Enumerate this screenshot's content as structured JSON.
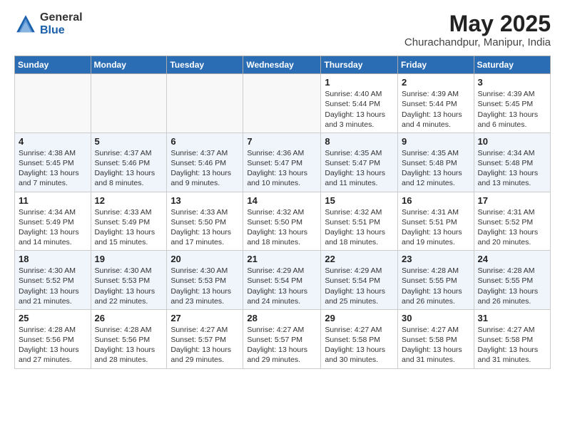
{
  "logo": {
    "general": "General",
    "blue": "Blue"
  },
  "title": "May 2025",
  "subtitle": "Churachandpur, Manipur, India",
  "headers": [
    "Sunday",
    "Monday",
    "Tuesday",
    "Wednesday",
    "Thursday",
    "Friday",
    "Saturday"
  ],
  "rows": [
    [
      {
        "day": "",
        "info": ""
      },
      {
        "day": "",
        "info": ""
      },
      {
        "day": "",
        "info": ""
      },
      {
        "day": "",
        "info": ""
      },
      {
        "day": "1",
        "info": "Sunrise: 4:40 AM\nSunset: 5:44 PM\nDaylight: 13 hours and 3 minutes."
      },
      {
        "day": "2",
        "info": "Sunrise: 4:39 AM\nSunset: 5:44 PM\nDaylight: 13 hours and 4 minutes."
      },
      {
        "day": "3",
        "info": "Sunrise: 4:39 AM\nSunset: 5:45 PM\nDaylight: 13 hours and 6 minutes."
      }
    ],
    [
      {
        "day": "4",
        "info": "Sunrise: 4:38 AM\nSunset: 5:45 PM\nDaylight: 13 hours and 7 minutes."
      },
      {
        "day": "5",
        "info": "Sunrise: 4:37 AM\nSunset: 5:46 PM\nDaylight: 13 hours and 8 minutes."
      },
      {
        "day": "6",
        "info": "Sunrise: 4:37 AM\nSunset: 5:46 PM\nDaylight: 13 hours and 9 minutes."
      },
      {
        "day": "7",
        "info": "Sunrise: 4:36 AM\nSunset: 5:47 PM\nDaylight: 13 hours and 10 minutes."
      },
      {
        "day": "8",
        "info": "Sunrise: 4:35 AM\nSunset: 5:47 PM\nDaylight: 13 hours and 11 minutes."
      },
      {
        "day": "9",
        "info": "Sunrise: 4:35 AM\nSunset: 5:48 PM\nDaylight: 13 hours and 12 minutes."
      },
      {
        "day": "10",
        "info": "Sunrise: 4:34 AM\nSunset: 5:48 PM\nDaylight: 13 hours and 13 minutes."
      }
    ],
    [
      {
        "day": "11",
        "info": "Sunrise: 4:34 AM\nSunset: 5:49 PM\nDaylight: 13 hours and 14 minutes."
      },
      {
        "day": "12",
        "info": "Sunrise: 4:33 AM\nSunset: 5:49 PM\nDaylight: 13 hours and 15 minutes."
      },
      {
        "day": "13",
        "info": "Sunrise: 4:33 AM\nSunset: 5:50 PM\nDaylight: 13 hours and 17 minutes."
      },
      {
        "day": "14",
        "info": "Sunrise: 4:32 AM\nSunset: 5:50 PM\nDaylight: 13 hours and 18 minutes."
      },
      {
        "day": "15",
        "info": "Sunrise: 4:32 AM\nSunset: 5:51 PM\nDaylight: 13 hours and 18 minutes."
      },
      {
        "day": "16",
        "info": "Sunrise: 4:31 AM\nSunset: 5:51 PM\nDaylight: 13 hours and 19 minutes."
      },
      {
        "day": "17",
        "info": "Sunrise: 4:31 AM\nSunset: 5:52 PM\nDaylight: 13 hours and 20 minutes."
      }
    ],
    [
      {
        "day": "18",
        "info": "Sunrise: 4:30 AM\nSunset: 5:52 PM\nDaylight: 13 hours and 21 minutes."
      },
      {
        "day": "19",
        "info": "Sunrise: 4:30 AM\nSunset: 5:53 PM\nDaylight: 13 hours and 22 minutes."
      },
      {
        "day": "20",
        "info": "Sunrise: 4:30 AM\nSunset: 5:53 PM\nDaylight: 13 hours and 23 minutes."
      },
      {
        "day": "21",
        "info": "Sunrise: 4:29 AM\nSunset: 5:54 PM\nDaylight: 13 hours and 24 minutes."
      },
      {
        "day": "22",
        "info": "Sunrise: 4:29 AM\nSunset: 5:54 PM\nDaylight: 13 hours and 25 minutes."
      },
      {
        "day": "23",
        "info": "Sunrise: 4:28 AM\nSunset: 5:55 PM\nDaylight: 13 hours and 26 minutes."
      },
      {
        "day": "24",
        "info": "Sunrise: 4:28 AM\nSunset: 5:55 PM\nDaylight: 13 hours and 26 minutes."
      }
    ],
    [
      {
        "day": "25",
        "info": "Sunrise: 4:28 AM\nSunset: 5:56 PM\nDaylight: 13 hours and 27 minutes."
      },
      {
        "day": "26",
        "info": "Sunrise: 4:28 AM\nSunset: 5:56 PM\nDaylight: 13 hours and 28 minutes."
      },
      {
        "day": "27",
        "info": "Sunrise: 4:27 AM\nSunset: 5:57 PM\nDaylight: 13 hours and 29 minutes."
      },
      {
        "day": "28",
        "info": "Sunrise: 4:27 AM\nSunset: 5:57 PM\nDaylight: 13 hours and 29 minutes."
      },
      {
        "day": "29",
        "info": "Sunrise: 4:27 AM\nSunset: 5:58 PM\nDaylight: 13 hours and 30 minutes."
      },
      {
        "day": "30",
        "info": "Sunrise: 4:27 AM\nSunset: 5:58 PM\nDaylight: 13 hours and 31 minutes."
      },
      {
        "day": "31",
        "info": "Sunrise: 4:27 AM\nSunset: 5:58 PM\nDaylight: 13 hours and 31 minutes."
      }
    ]
  ]
}
